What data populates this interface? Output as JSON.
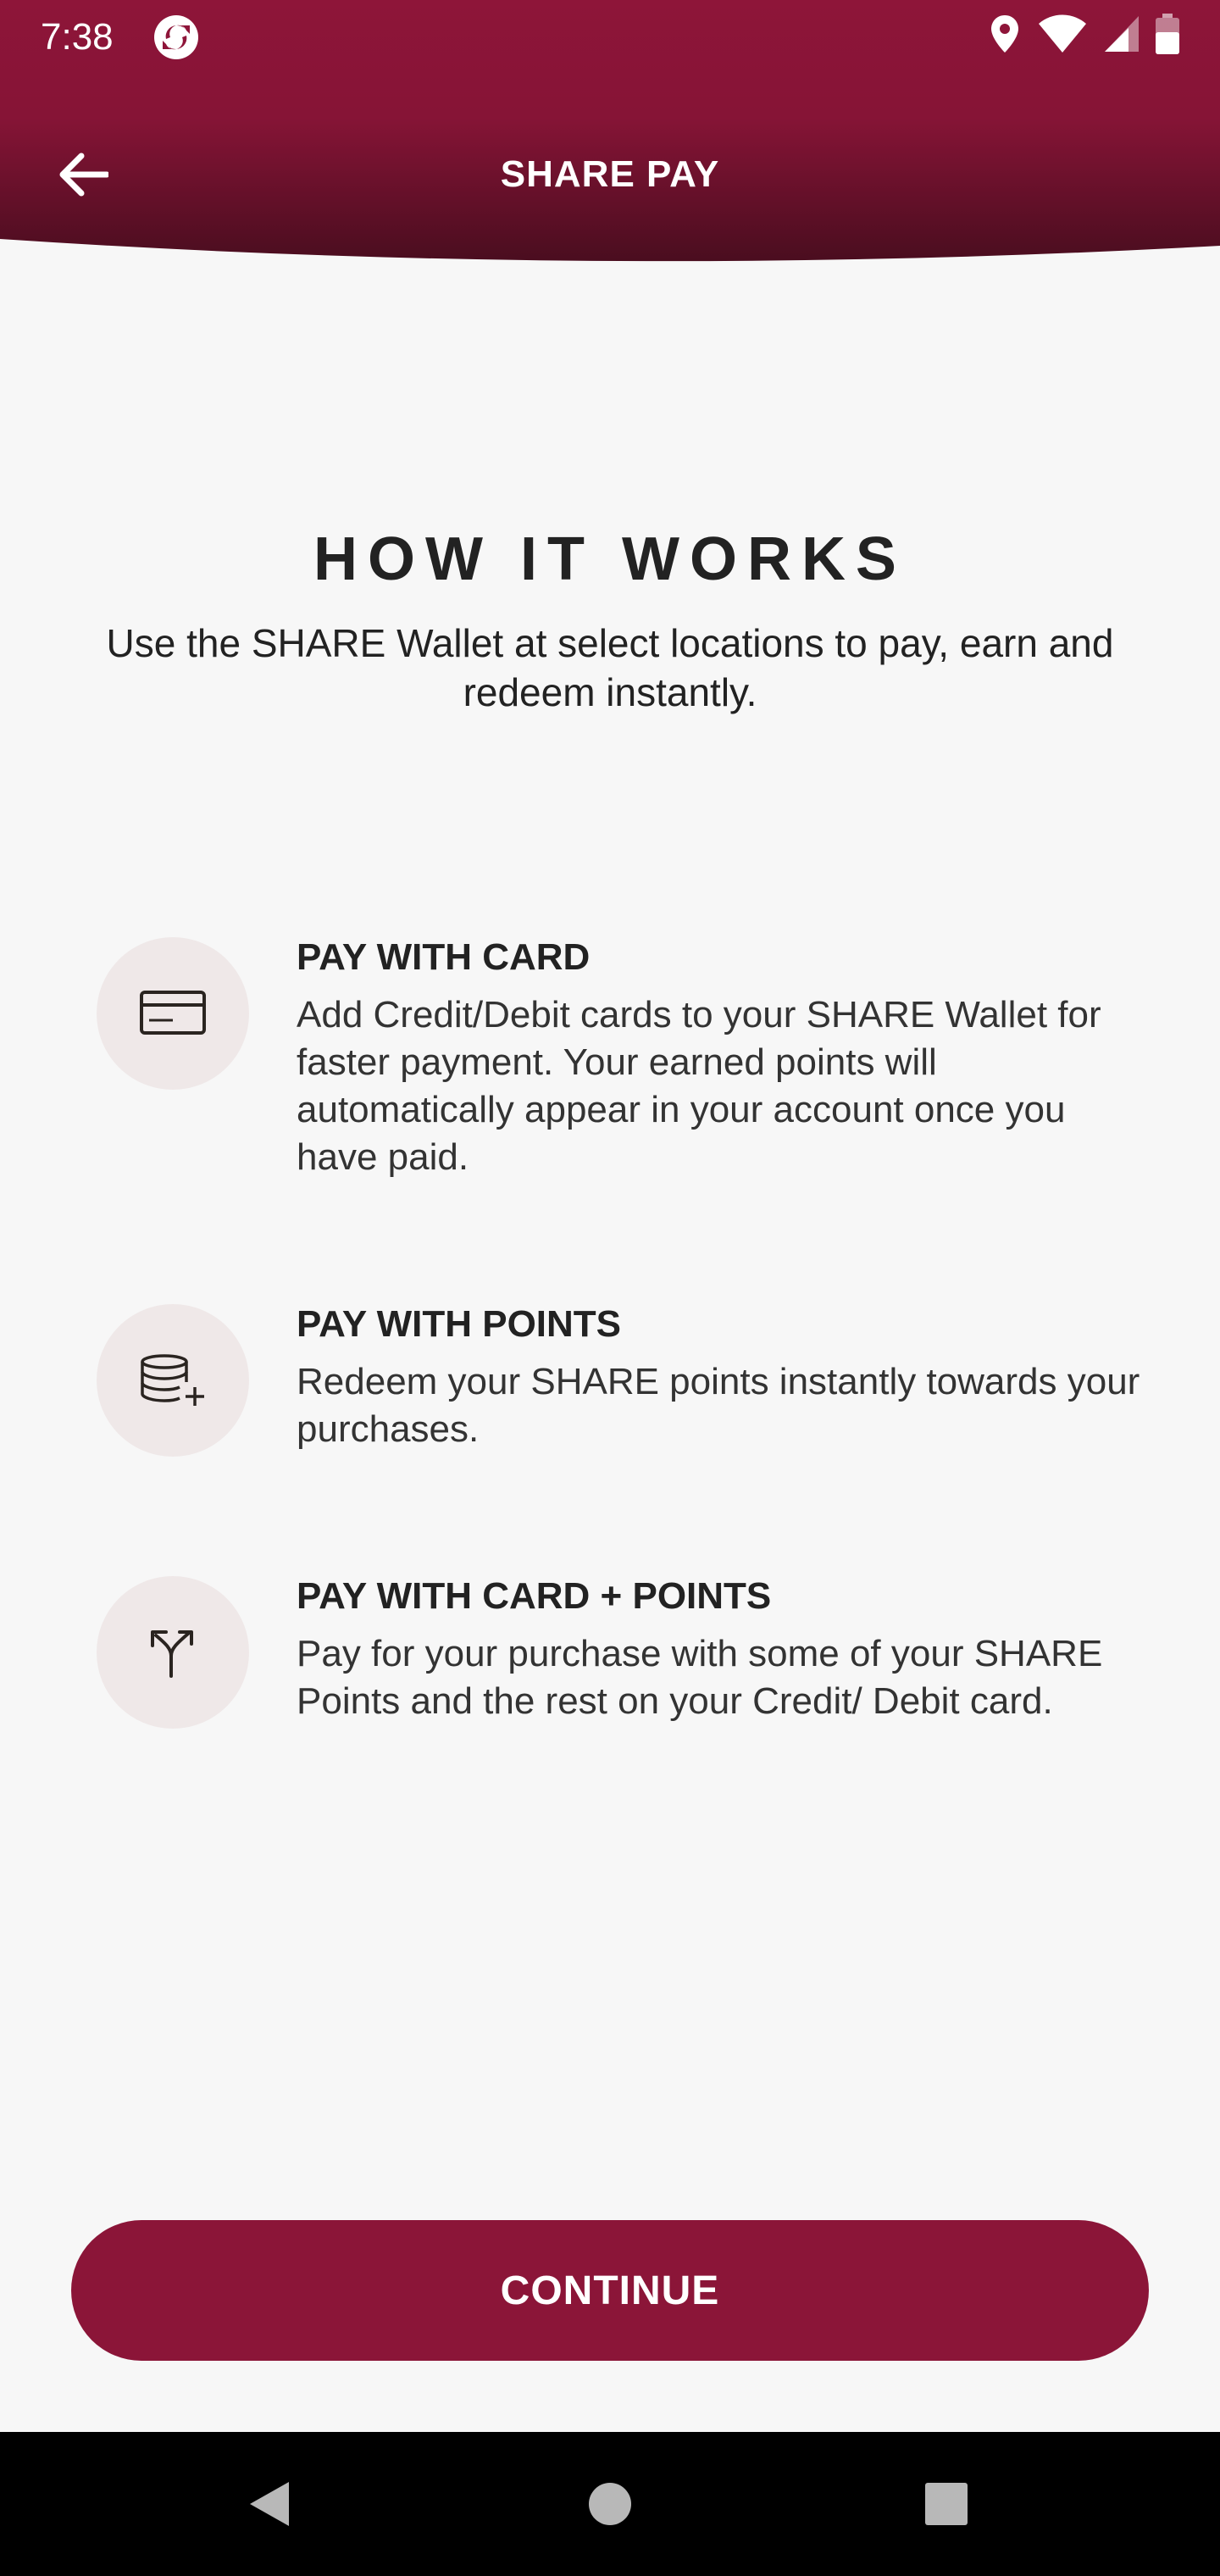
{
  "colors": {
    "brand": "#8b1538",
    "brand_dark": "#4d0c1f",
    "background": "#f7f7f7",
    "icon_circle": "#efe8e8",
    "text": "#222222"
  },
  "status_bar": {
    "time": "7:38",
    "icons": [
      "app-sync-icon",
      "location-icon",
      "wifi-icon",
      "signal-icon",
      "battery-icon"
    ]
  },
  "header": {
    "title": "SHARE PAY",
    "back_icon": "arrow-left-icon"
  },
  "intro": {
    "title": "HOW IT WORKS",
    "description": "Use the SHARE Wallet at select locations to pay, earn and redeem instantly."
  },
  "features": [
    {
      "icon": "credit-card-icon",
      "title": "PAY WITH CARD",
      "description": "Add Credit/Debit cards to your SHARE Wallet for faster payment. Your earned points will automatically appear in your account once you have paid."
    },
    {
      "icon": "coins-plus-icon",
      "title": "PAY WITH POINTS",
      "description": "Redeem your SHARE points instantly towards your purchases."
    },
    {
      "icon": "split-arrow-icon",
      "title": "PAY WITH CARD + POINTS",
      "description": "Pay for your purchase with some of your SHARE Points and the rest on your Credit/ Debit card."
    }
  ],
  "continue_button": {
    "label": "CONTINUE"
  },
  "nav_bar": {
    "icons": [
      "back-triangle-icon",
      "home-circle-icon",
      "recents-square-icon"
    ]
  }
}
